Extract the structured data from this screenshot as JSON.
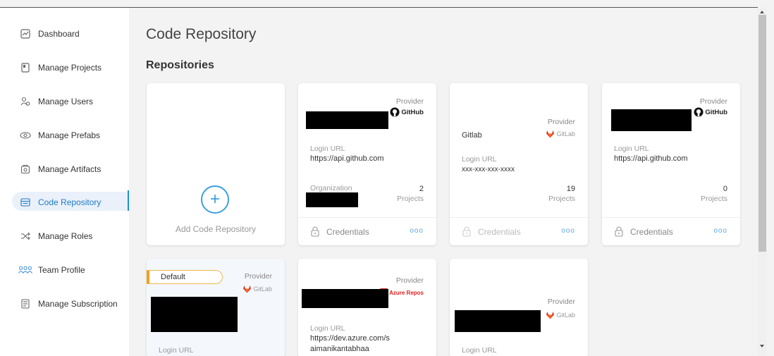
{
  "sidebar": {
    "items": [
      {
        "label": "Dashboard",
        "icon": "dashboard-icon"
      },
      {
        "label": "Manage Projects",
        "icon": "projects-icon"
      },
      {
        "label": "Manage Users",
        "icon": "users-icon"
      },
      {
        "label": "Manage Prefabs",
        "icon": "prefabs-icon"
      },
      {
        "label": "Manage Artifacts",
        "icon": "artifacts-icon"
      },
      {
        "label": "Code Repository",
        "icon": "repository-icon",
        "active": true
      },
      {
        "label": "Manage Roles",
        "icon": "roles-icon"
      },
      {
        "label": "Team Profile",
        "icon": "team-icon"
      },
      {
        "label": "Manage Subscription",
        "icon": "subscription-icon"
      }
    ]
  },
  "main": {
    "title": "Code Repository",
    "section": "Repositories",
    "add_card_label": "Add Code Repository",
    "add_symbol": "+",
    "more_symbol": "ooo",
    "cards": [
      {
        "provider_label": "Provider",
        "provider": "GitHub",
        "login_url_label": "Login URL",
        "login_url": "https://api.github.com",
        "org_label": "Organization",
        "projects_count": "2",
        "projects_label": "Projects",
        "credentials_label": "Credentials"
      },
      {
        "provider_label": "Provider",
        "provider": "GitLab",
        "name": "Gitlab",
        "login_url_label": "Login URL",
        "login_url": "xxx-xxx-xxx-xxxx",
        "projects_count": "19",
        "projects_label": "Projects",
        "credentials_label": "Credentials"
      },
      {
        "provider_label": "Provider",
        "provider": "GitHub",
        "login_url_label": "Login URL",
        "login_url": "https://api.github.com",
        "projects_count": "0",
        "projects_label": "Projects",
        "credentials_label": "Credentials"
      },
      {
        "provider_label": "Provider",
        "provider": "GitLab",
        "badge": "Default",
        "login_url_label": "Login URL"
      },
      {
        "provider_label": "Provider",
        "provider": "Azure Repos",
        "login_url_label": "Login URL",
        "login_url": "https://dev.azure.com/saimanikantabhaa"
      },
      {
        "provider_label": "Provider",
        "provider": "GitLab",
        "login_url_label": "Login URL"
      }
    ]
  },
  "colors": {
    "accent": "#1e90d6",
    "badge": "#f0a020",
    "gitlab": "#e24329",
    "azure": "#d22222"
  }
}
